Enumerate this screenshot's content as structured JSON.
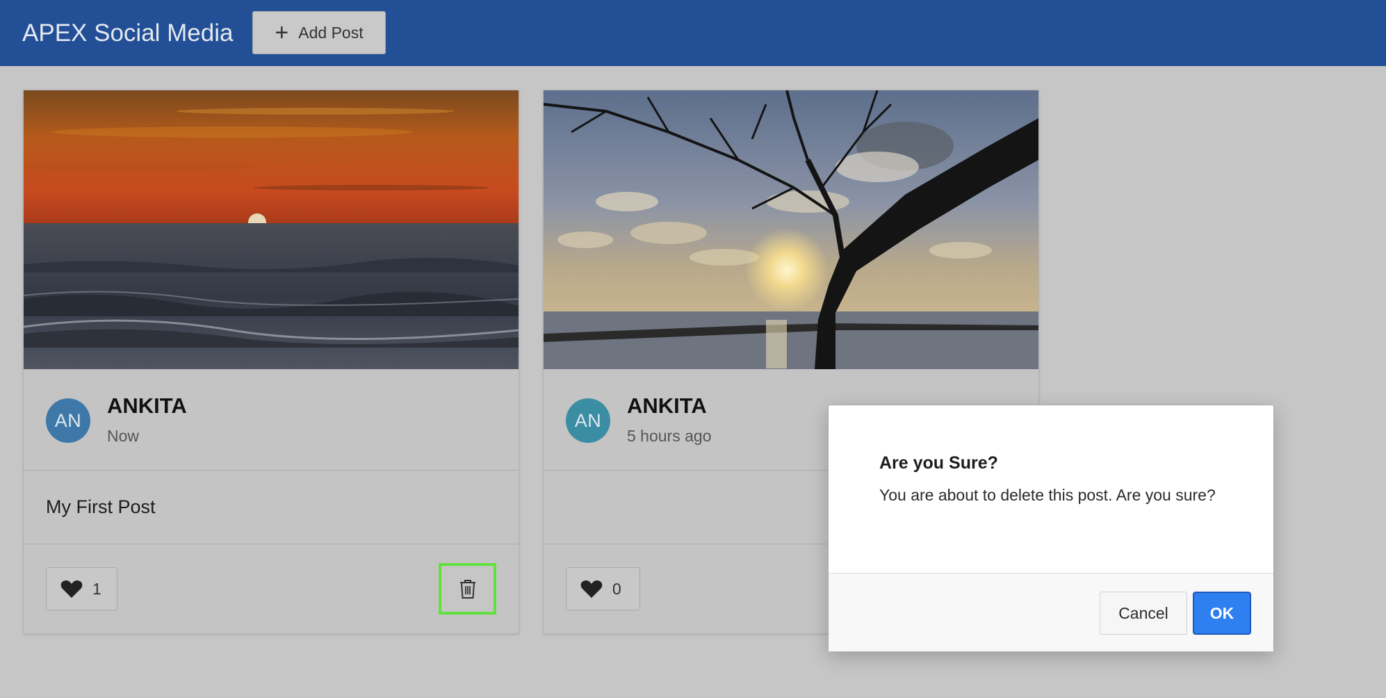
{
  "header": {
    "app_title": "APEX Social Media",
    "add_post_label": "Add Post",
    "background_color": "#224f95"
  },
  "posts": [
    {
      "image": "ocean sunset",
      "avatar_initials": "AN",
      "author": "ANKITA",
      "time": "Now",
      "text": "My First Post",
      "likes": "1",
      "has_delete": true
    },
    {
      "image": "tree branch silhouette at beach sunset",
      "avatar_initials": "AN",
      "author": "ANKITA",
      "time": "5 hours ago",
      "text": "",
      "likes": "0",
      "has_delete": false
    }
  ],
  "dialog": {
    "title": "Are you Sure?",
    "message": "You are about to delete this post. Are you sure?",
    "cancel_label": "Cancel",
    "ok_label": "OK",
    "ok_color": "#2e7ff0"
  },
  "icons": {
    "add": "plus-icon",
    "like": "heart-icon",
    "delete": "trash-icon"
  }
}
